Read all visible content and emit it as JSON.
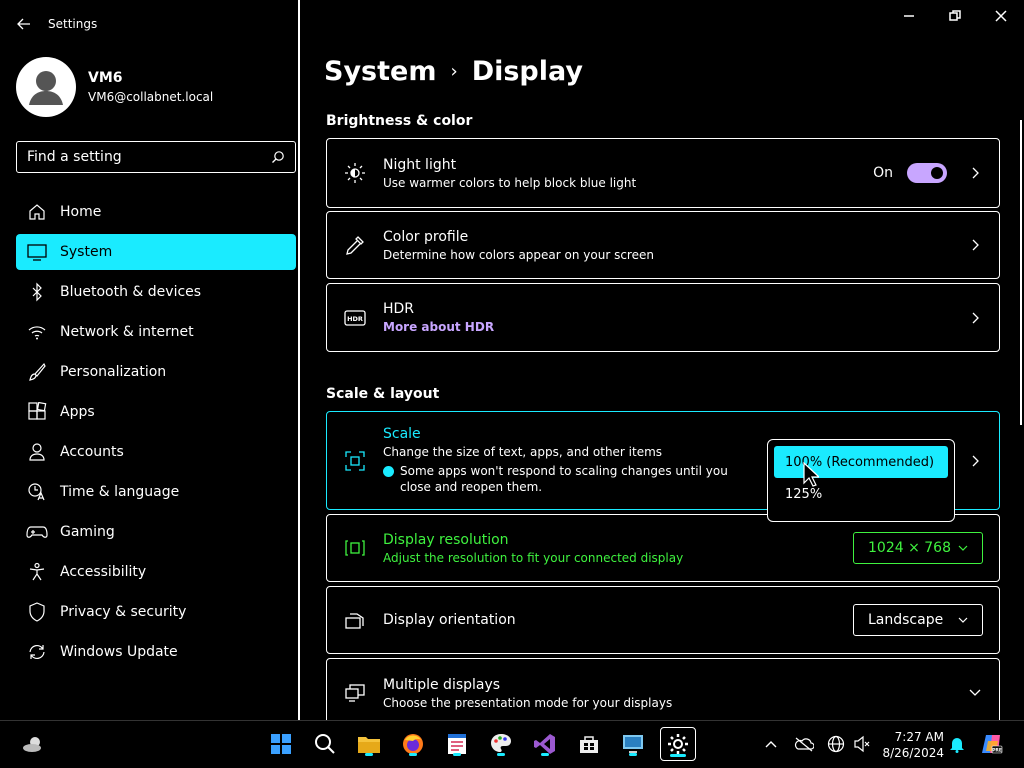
{
  "app": {
    "title": "Settings"
  },
  "profile": {
    "name": "VM6",
    "email": "VM6@collabnet.local"
  },
  "search": {
    "placeholder": "Find a setting"
  },
  "nav": {
    "items": [
      {
        "label": "Home",
        "icon": "home-icon"
      },
      {
        "label": "System",
        "icon": "monitor-icon",
        "active": true
      },
      {
        "label": "Bluetooth & devices",
        "icon": "bluetooth-icon"
      },
      {
        "label": "Network & internet",
        "icon": "wifi-icon"
      },
      {
        "label": "Personalization",
        "icon": "brush-icon"
      },
      {
        "label": "Apps",
        "icon": "apps-icon"
      },
      {
        "label": "Accounts",
        "icon": "person-icon"
      },
      {
        "label": "Time & language",
        "icon": "clock-language-icon"
      },
      {
        "label": "Gaming",
        "icon": "gamepad-icon"
      },
      {
        "label": "Accessibility",
        "icon": "accessibility-icon"
      },
      {
        "label": "Privacy & security",
        "icon": "shield-icon"
      },
      {
        "label": "Windows Update",
        "icon": "update-icon"
      }
    ]
  },
  "breadcrumb": {
    "parent": "System",
    "separator": "›",
    "current": "Display"
  },
  "sections": {
    "brightness": "Brightness & color",
    "scale": "Scale & layout"
  },
  "night_light": {
    "title": "Night light",
    "desc": "Use warmer colors to help block blue light",
    "state": "On"
  },
  "color_profile": {
    "title": "Color profile",
    "desc": "Determine how colors appear on your screen"
  },
  "hdr": {
    "title": "HDR",
    "link": "More about HDR"
  },
  "scale": {
    "title": "Scale",
    "desc": "Change the size of text, apps, and other items",
    "note_line1": "Some apps won't respond to scaling changes until you",
    "note_line2": "close and reopen them.",
    "options": [
      "100% (Recommended)",
      "125%"
    ]
  },
  "resolution": {
    "title": "Display resolution",
    "desc": "Adjust the resolution to fit your connected display",
    "value": "1024 × 768"
  },
  "orientation": {
    "title": "Display orientation",
    "value": "Landscape"
  },
  "multiple": {
    "title": "Multiple displays",
    "desc": "Choose the presentation mode for your displays"
  },
  "taskbar": {
    "time": "7:27 AM",
    "date": "8/26/2024"
  },
  "colors": {
    "accent": "#1aebff",
    "toggle": "#c8a6ff",
    "highlight_green": "#3ff23f"
  }
}
